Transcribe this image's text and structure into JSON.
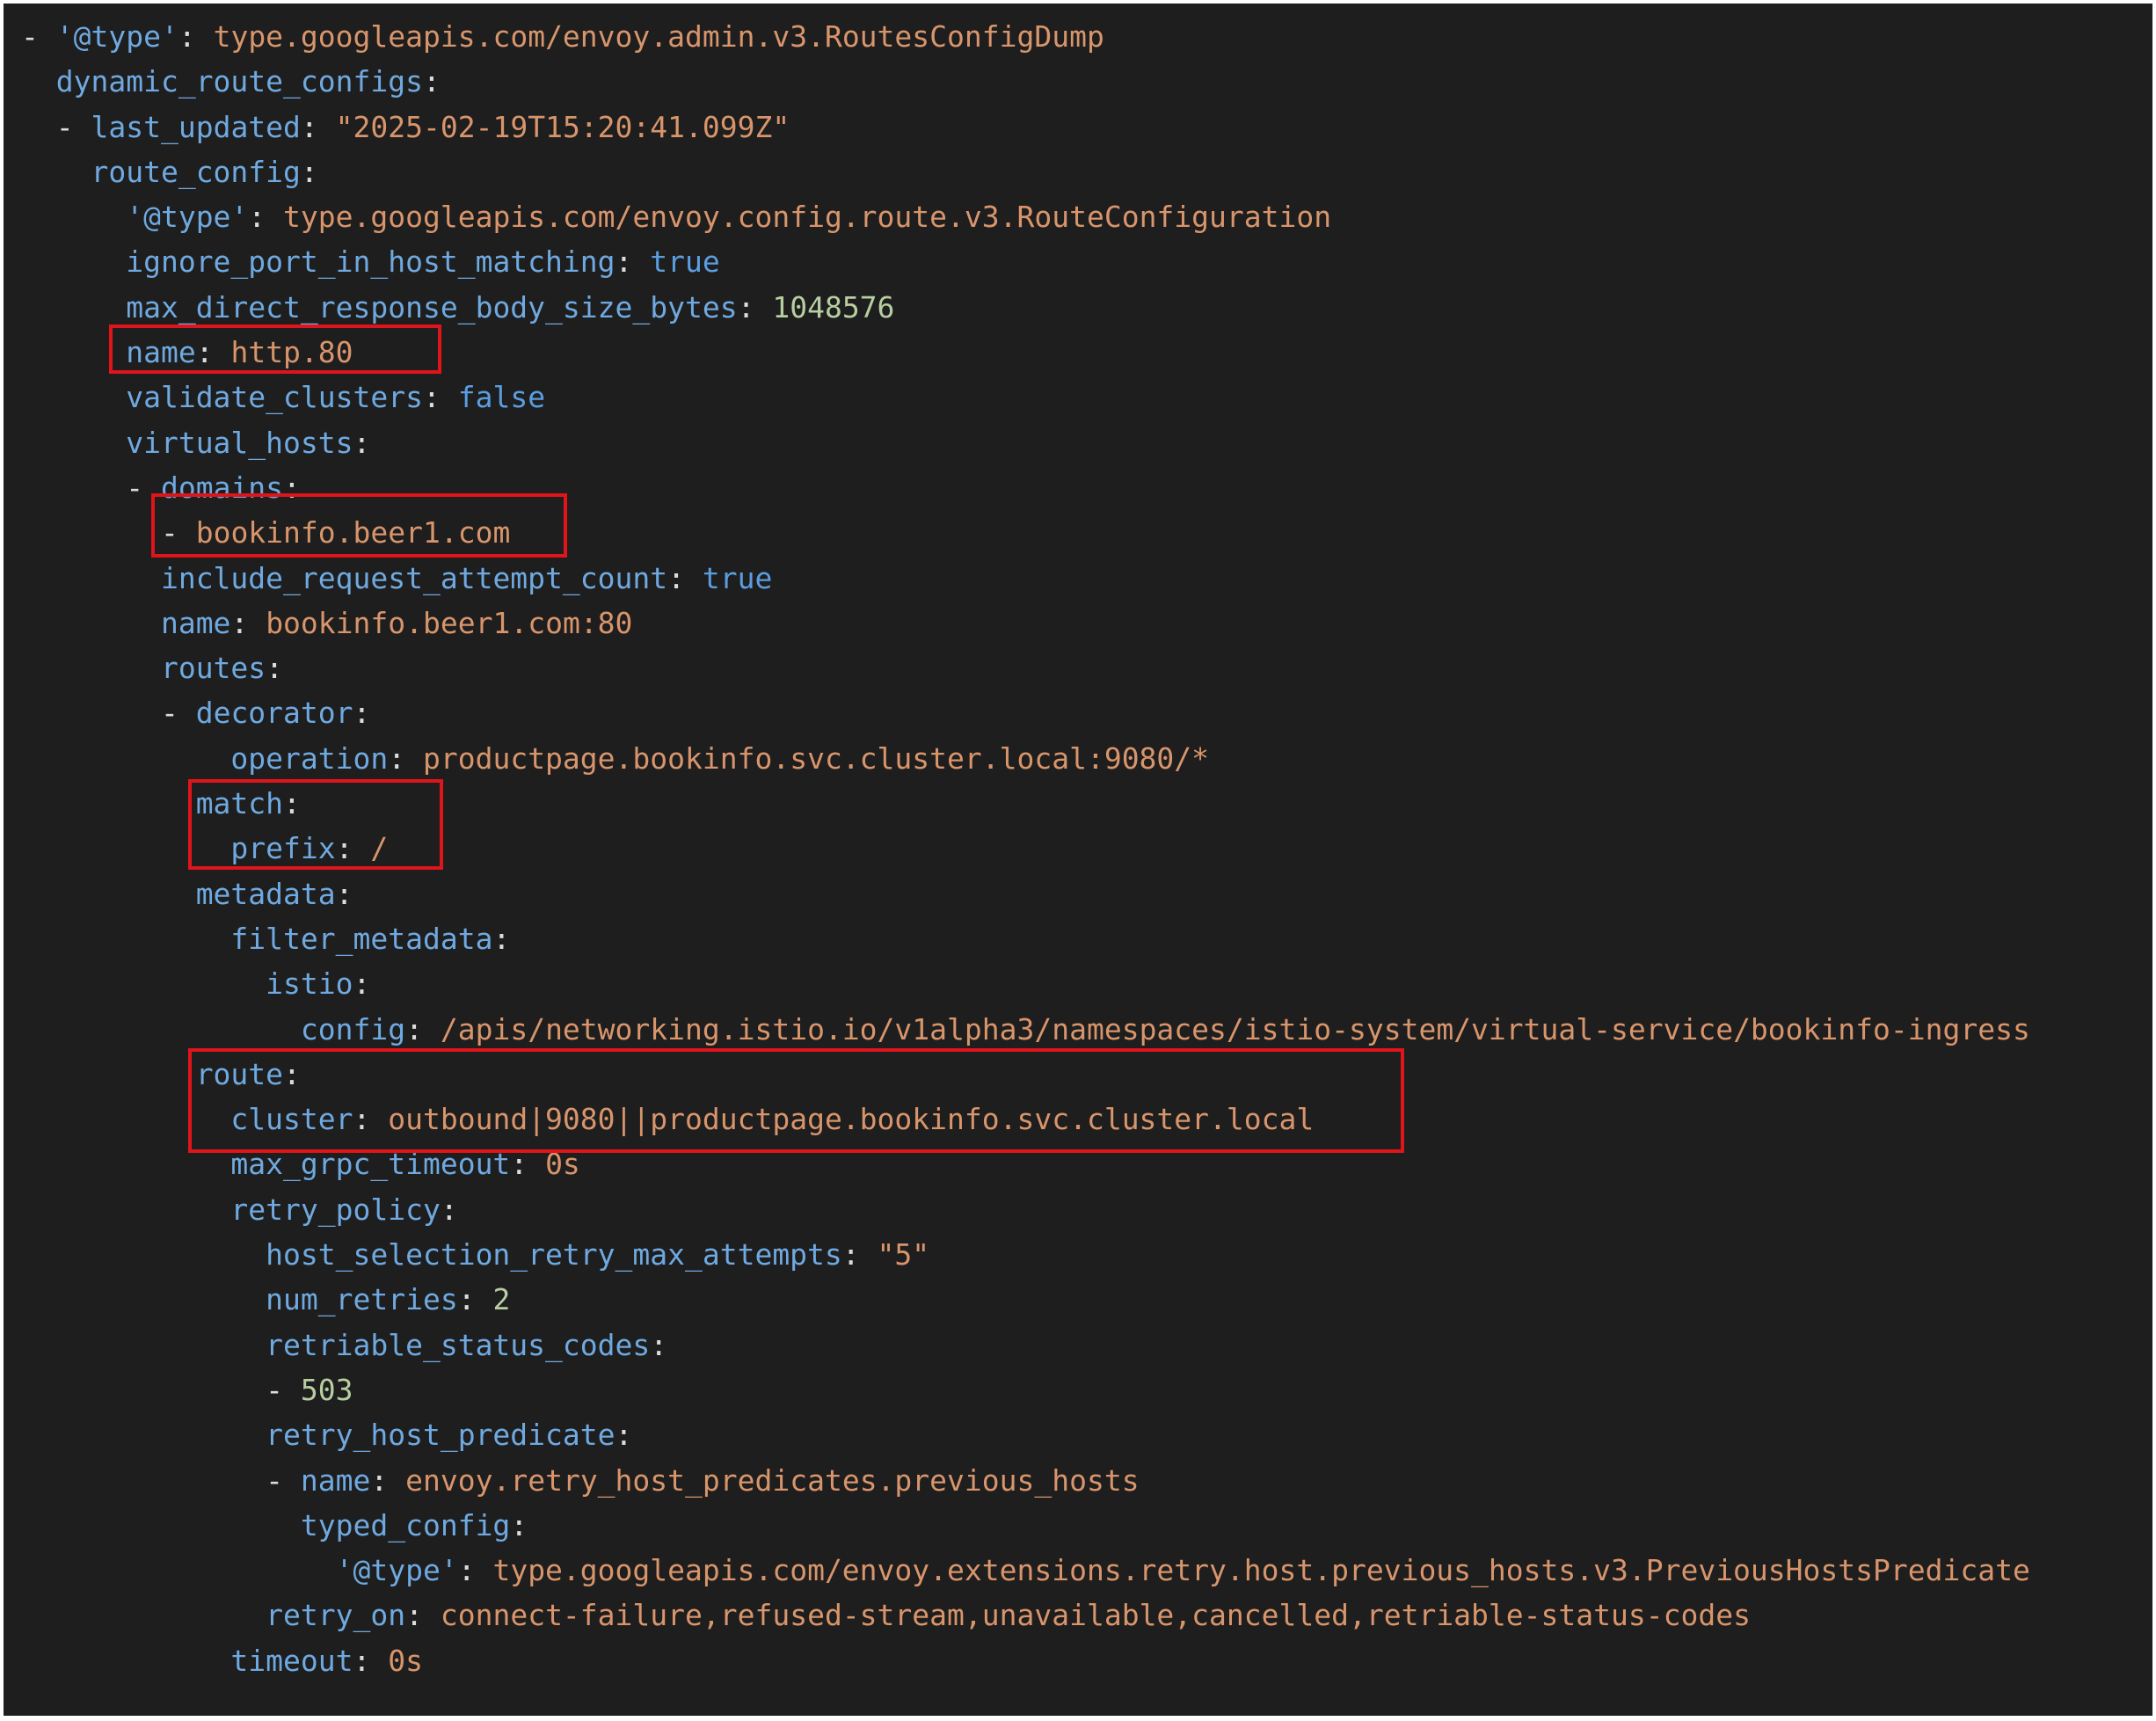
{
  "lines": [
    {
      "dash": "- ",
      "key": "'@type'",
      "value": "type.googleapis.com/envoy.admin.v3.RoutesConfigDump",
      "vtype": "s"
    },
    {
      "indent": "  ",
      "key": "dynamic_route_configs"
    },
    {
      "indent": "  ",
      "dash": "- ",
      "key": "last_updated",
      "value": "\"2025-02-19T15:20:41.099Z\"",
      "vtype": "s"
    },
    {
      "indent": "    ",
      "key": "route_config"
    },
    {
      "indent": "      ",
      "key": "'@type'",
      "value": "type.googleapis.com/envoy.config.route.v3.RouteConfiguration",
      "vtype": "s"
    },
    {
      "indent": "      ",
      "key": "ignore_port_in_host_matching",
      "value": "true",
      "vtype": "b"
    },
    {
      "indent": "      ",
      "key": "max_direct_response_body_size_bytes",
      "value": "1048576",
      "vtype": "n"
    },
    {
      "indent": "      ",
      "key": "name",
      "value": "http.80",
      "vtype": "s"
    },
    {
      "indent": "      ",
      "key": "validate_clusters",
      "value": "false",
      "vtype": "b"
    },
    {
      "indent": "      ",
      "key": "virtual_hosts"
    },
    {
      "indent": "      ",
      "dash": "- ",
      "key": "domains"
    },
    {
      "indent": "        ",
      "dash": "- ",
      "value": "bookinfo.beer1.com",
      "vtype": "s"
    },
    {
      "indent": "        ",
      "key": "include_request_attempt_count",
      "value": "true",
      "vtype": "b"
    },
    {
      "indent": "        ",
      "key": "name",
      "value": "bookinfo.beer1.com:80",
      "vtype": "s"
    },
    {
      "indent": "        ",
      "key": "routes"
    },
    {
      "indent": "        ",
      "dash": "- ",
      "key": "decorator"
    },
    {
      "indent": "            ",
      "key": "operation",
      "value": "productpage.bookinfo.svc.cluster.local:9080/*",
      "vtype": "s"
    },
    {
      "indent": "          ",
      "key": "match"
    },
    {
      "indent": "            ",
      "key": "prefix",
      "value": "/",
      "vtype": "s"
    },
    {
      "indent": "          ",
      "key": "metadata"
    },
    {
      "indent": "            ",
      "key": "filter_metadata"
    },
    {
      "indent": "              ",
      "key": "istio"
    },
    {
      "indent": "                ",
      "key": "config",
      "value": "/apis/networking.istio.io/v1alpha3/namespaces/istio-system/virtual-service/bookinfo-ingress",
      "vtype": "s"
    },
    {
      "indent": "          ",
      "key": "route"
    },
    {
      "indent": "            ",
      "key": "cluster",
      "value": "outbound|9080||productpage.bookinfo.svc.cluster.local",
      "vtype": "s"
    },
    {
      "indent": "            ",
      "key": "max_grpc_timeout",
      "value": "0s",
      "vtype": "s"
    },
    {
      "indent": "            ",
      "key": "retry_policy"
    },
    {
      "indent": "              ",
      "key": "host_selection_retry_max_attempts",
      "value": "\"5\"",
      "vtype": "s"
    },
    {
      "indent": "              ",
      "key": "num_retries",
      "value": "2",
      "vtype": "n"
    },
    {
      "indent": "              ",
      "key": "retriable_status_codes"
    },
    {
      "indent": "              ",
      "dash": "- ",
      "value": "503",
      "vtype": "n"
    },
    {
      "indent": "              ",
      "key": "retry_host_predicate"
    },
    {
      "indent": "              ",
      "dash": "- ",
      "key": "name",
      "value": "envoy.retry_host_predicates.previous_hosts",
      "vtype": "s"
    },
    {
      "indent": "                ",
      "key": "typed_config"
    },
    {
      "indent": "                  ",
      "key": "'@type'",
      "value": "type.googleapis.com/envoy.extensions.retry.host.previous_hosts.v3.PreviousHostsPredicate",
      "vtype": "s"
    },
    {
      "indent": "              ",
      "key": "retry_on",
      "value": "connect-failure,refused-stream,unavailable,cancelled,retriable-status-codes",
      "vtype": "s"
    },
    {
      "indent": "            ",
      "key": "timeout",
      "value": "0s",
      "vtype": "s"
    }
  ],
  "colors": {
    "background": "#1e1e1e",
    "key": "#6fa9e0",
    "string": "#d8956c",
    "number": "#b7cea1",
    "boolean": "#5a9ee0",
    "highlight_box": "#e0141b"
  }
}
